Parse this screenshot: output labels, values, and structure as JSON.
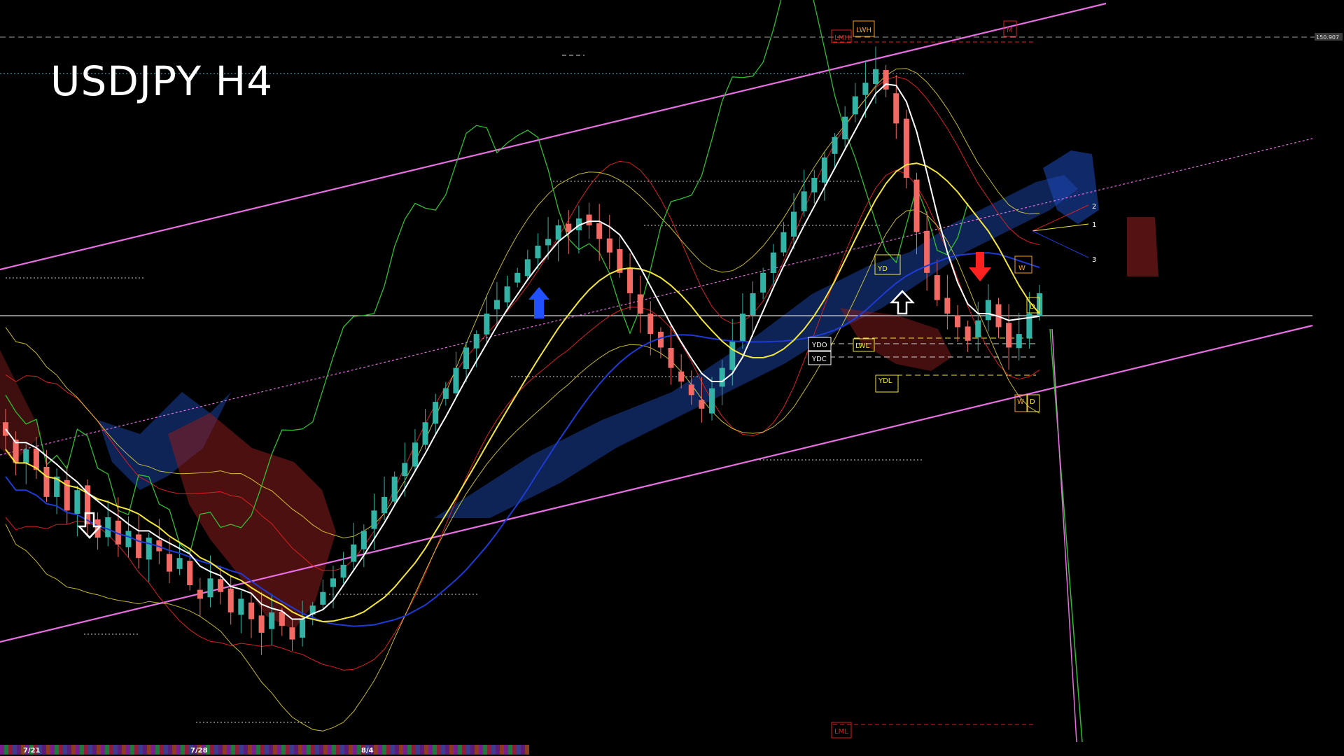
{
  "chart_title": "USDJPY H4",
  "price_tag": "150.907",
  "level_labels": {
    "lmh": "LMH",
    "lwh": "LWH",
    "m": "M",
    "lml": "LML",
    "lwl": "LWL",
    "ydo": "YDO",
    "ydc": "YDC",
    "ydl": "YDL",
    "yd": "YD",
    "w_top": "W",
    "w_bottom": "W",
    "d_top": "D",
    "d_bottom": "D"
  },
  "fan_labels": [
    "2",
    "1",
    "3"
  ],
  "date_labels": [
    "7/21",
    "7/28",
    "8/4"
  ],
  "colors": {
    "background": "#000000",
    "bull_candle": "#33b3a6",
    "bear_candle": "#f26a63",
    "channel": "#e76fe2",
    "ma_white": "#ffffff",
    "ma_yellow": "#f5e63a",
    "ma_blue": "#1f3bd6",
    "bollinger": "#d92020",
    "ichimoku_cloud": "#1e4dbf",
    "ichimoku_cloud_bear": "#8c1e1e",
    "chikou": "#2fbf2f",
    "arrow_up": "#ffffff",
    "arrow_blue": "#2050ff",
    "arrow_red": "#ff2020"
  },
  "chart_data": {
    "type": "candlestick",
    "symbol": "USDJPY",
    "timeframe": "H4",
    "title": "USDJPY H4",
    "x_tick_labels": [
      "7/21",
      "7/28",
      "8/4"
    ],
    "ylim": [
      0,
      100
    ],
    "closes": [
      42,
      38,
      40,
      37,
      33,
      36,
      31,
      34,
      29,
      27,
      30,
      26,
      28,
      24,
      27,
      25,
      22,
      24,
      20,
      18,
      21,
      19,
      16,
      18,
      15,
      13,
      16,
      14,
      12,
      15,
      17,
      19,
      21,
      23,
      26,
      28,
      31,
      33,
      36,
      38,
      41,
      44,
      47,
      49,
      52,
      55,
      57,
      60,
      62,
      64,
      66,
      68,
      70,
      71,
      73,
      72,
      74,
      73,
      71,
      69,
      66,
      63,
      60,
      57,
      55,
      52,
      50,
      48,
      46,
      49,
      52,
      56,
      60,
      63,
      66,
      69,
      72,
      75,
      78,
      80,
      83,
      86,
      89,
      92,
      94,
      96,
      93,
      88,
      80,
      72,
      66,
      62,
      60,
      58,
      56,
      59,
      62,
      58,
      55,
      57,
      60,
      63
    ]
  }
}
